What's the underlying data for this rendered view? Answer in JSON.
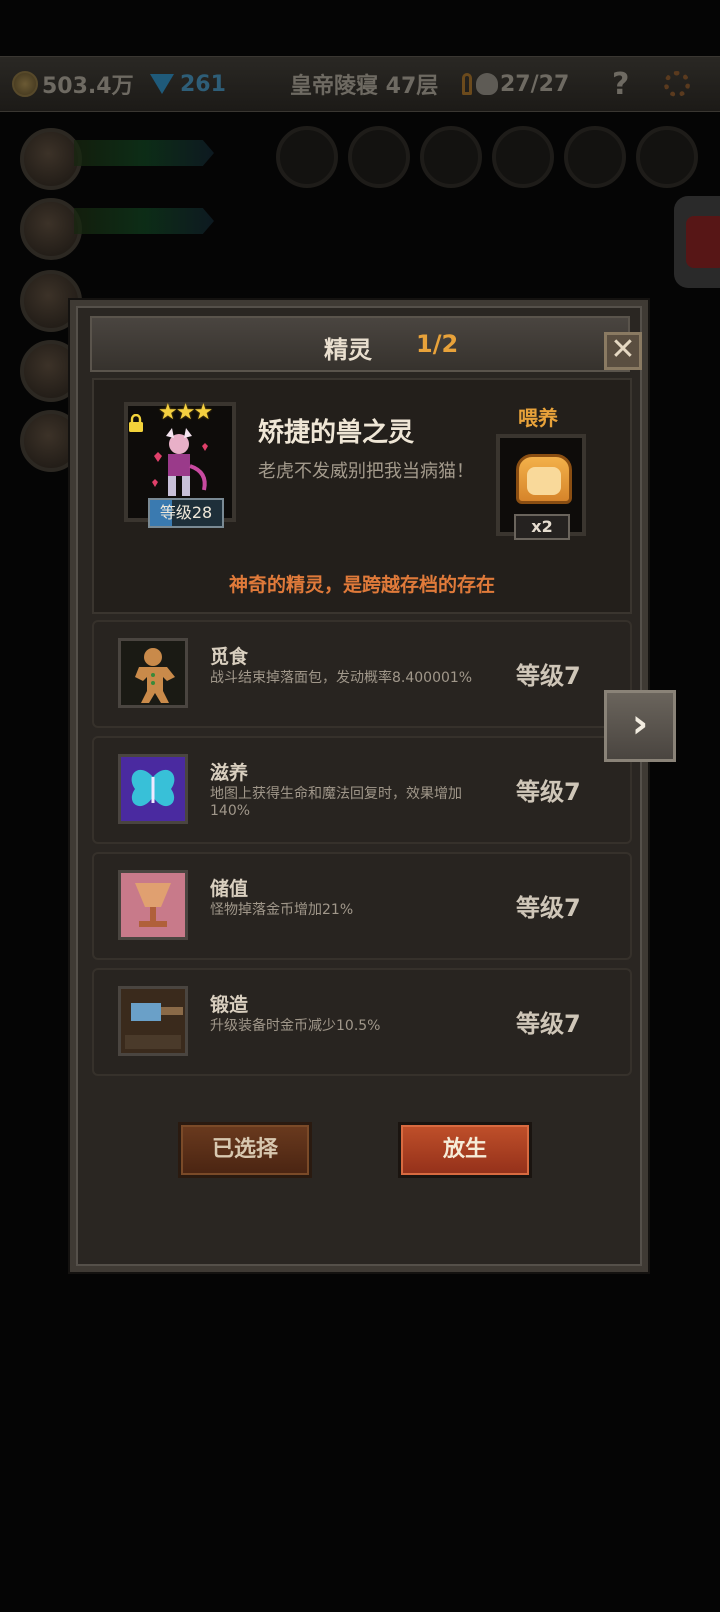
{
  "hud": {
    "gold": "503.4万",
    "gems": "261",
    "location": "皇帝陵寝 47层",
    "kills": "27/27",
    "help": "?"
  },
  "dialog": {
    "title": "精灵",
    "page": "1/2",
    "close": "✕",
    "sprite": {
      "stars": "★★★",
      "star_count": 3,
      "name": "矫捷的兽之灵",
      "description": "老虎不发威别把我当病猫！",
      "level": "等级28",
      "level_progress": 0.3,
      "feed_label": "喂养",
      "feed_count": "x2",
      "footer": "神奇的精灵，是跨越存档的存在"
    },
    "skills": [
      {
        "name": "觅食",
        "desc": "战斗结束掉落面包，发动概率8.400001%",
        "level": "等级7",
        "icon": "gingerbread-icon"
      },
      {
        "name": "滋养",
        "desc": "地图上获得生命和魔法回复时，效果增加140%",
        "level": "等级7",
        "icon": "butterfly-icon"
      },
      {
        "name": "储值",
        "desc": "怪物掉落金币增加21%",
        "level": "等级7",
        "icon": "goblet-icon"
      },
      {
        "name": "锻造",
        "desc": "升级装备时金币减少10.5%",
        "level": "等级7",
        "icon": "hammer-icon"
      }
    ],
    "buttons": {
      "selected": "已选择",
      "release": "放生"
    },
    "next": "›"
  },
  "colors": {
    "accent_orange": "#e8a23a",
    "footer_orange": "#e07a3a",
    "release_red": "#c0502a"
  }
}
